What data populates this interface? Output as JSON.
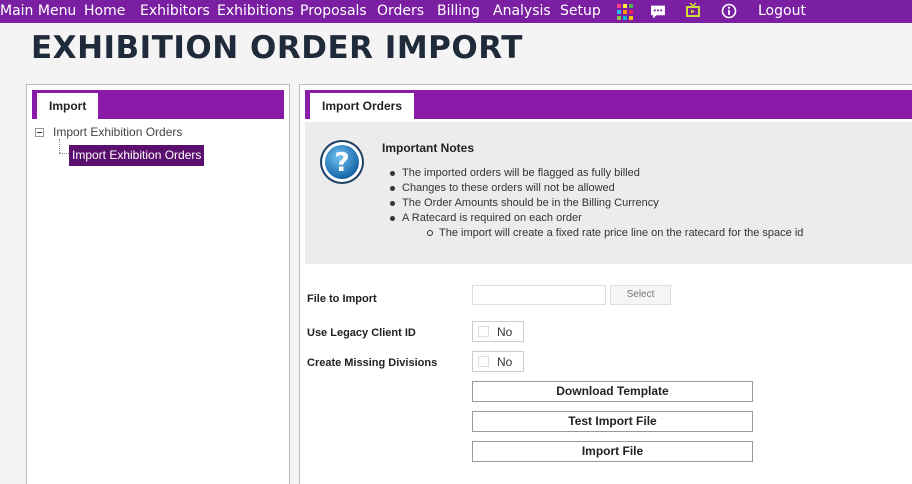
{
  "nav": {
    "items": [
      "Main Menu",
      "Home",
      "Exhibitors",
      "Exhibitions",
      "Proposals",
      "Orders",
      "Billing",
      "Analysis",
      "Setup"
    ],
    "logout": "Logout",
    "icons": [
      "grid-icon",
      "chat-icon",
      "tv-icon",
      "info-icon"
    ],
    "bar_color": "#7b1fa2"
  },
  "page": {
    "title": "EXHIBITION ORDER IMPORT"
  },
  "left": {
    "tab": "Import",
    "tree": {
      "root": "Import Exhibition Orders",
      "child": "Import Exhibition Orders"
    }
  },
  "right": {
    "tab": "Import Orders",
    "notes": {
      "title": "Important Notes",
      "items": [
        "The imported orders will be flagged as fully billed",
        "Changes to these orders will not be allowed",
        "The Order Amounts should be in the Billing Currency",
        "A Ratecard is required on each order"
      ],
      "subitem": "The import will create a fixed rate price line on the ratecard for the space id"
    },
    "form": {
      "file_label": "File to Import",
      "file_value": "",
      "select_label": "Select",
      "legacy_label": "Use Legacy Client ID",
      "legacy_value": "No",
      "divisions_label": "Create Missing Divisions",
      "divisions_value": "No"
    },
    "buttons": {
      "download": "Download Template",
      "test": "Test Import File",
      "import": "Import File"
    }
  }
}
